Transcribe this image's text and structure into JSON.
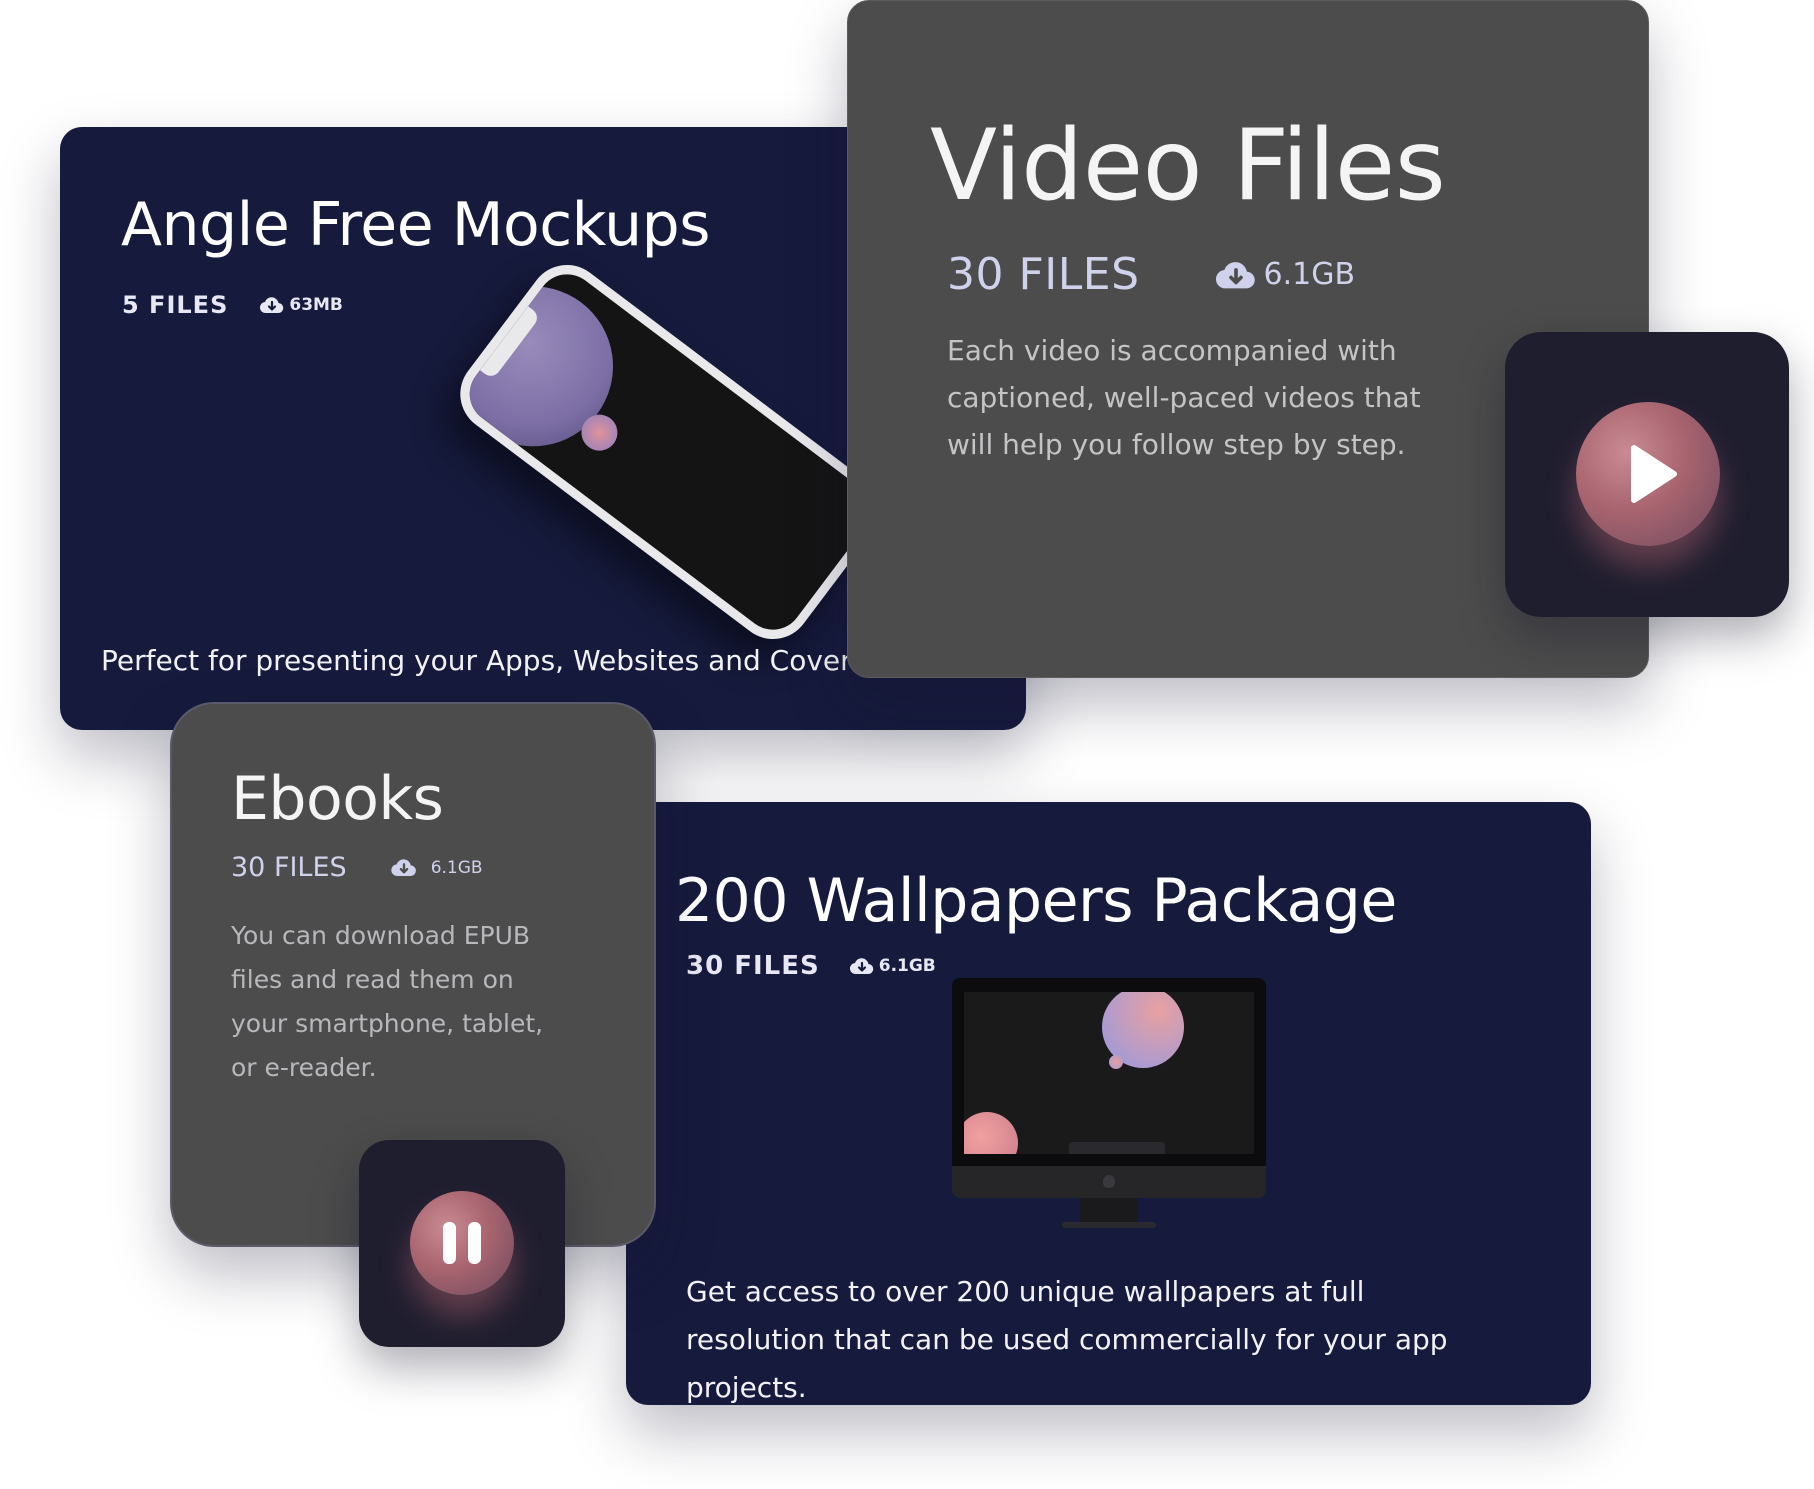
{
  "cards": {
    "mockups": {
      "title": "Angle Free Mockups",
      "files": "5 FILES",
      "size": "63MB",
      "description": "Perfect for presenting your Apps, Websites and Cover images"
    },
    "video": {
      "title": "Video Files",
      "files": "30 FILES",
      "size": "6.1GB",
      "description": "Each video is accompanied with captioned, well-paced videos that will help you follow step by step."
    },
    "ebooks": {
      "title": "Ebooks",
      "files": "30 FILES",
      "size": "6.1GB",
      "description": "You can download EPUB files and read them on your smartphone, tablet, or e-reader."
    },
    "wallpapers": {
      "title": "200 Wallpapers Package",
      "files": "30 FILES",
      "size": "6.1GB",
      "description": "Get access to over 200 unique wallpapers at full resolution that can be used commercially for your app projects."
    }
  },
  "icons": {
    "download": "cloud-download-icon",
    "play": "play-icon",
    "pause": "pause-icon"
  },
  "colors": {
    "navy": "#161a3c",
    "glass": "#4c4c4c",
    "tile": "#1f1e2f",
    "accent": "#c98a93"
  }
}
